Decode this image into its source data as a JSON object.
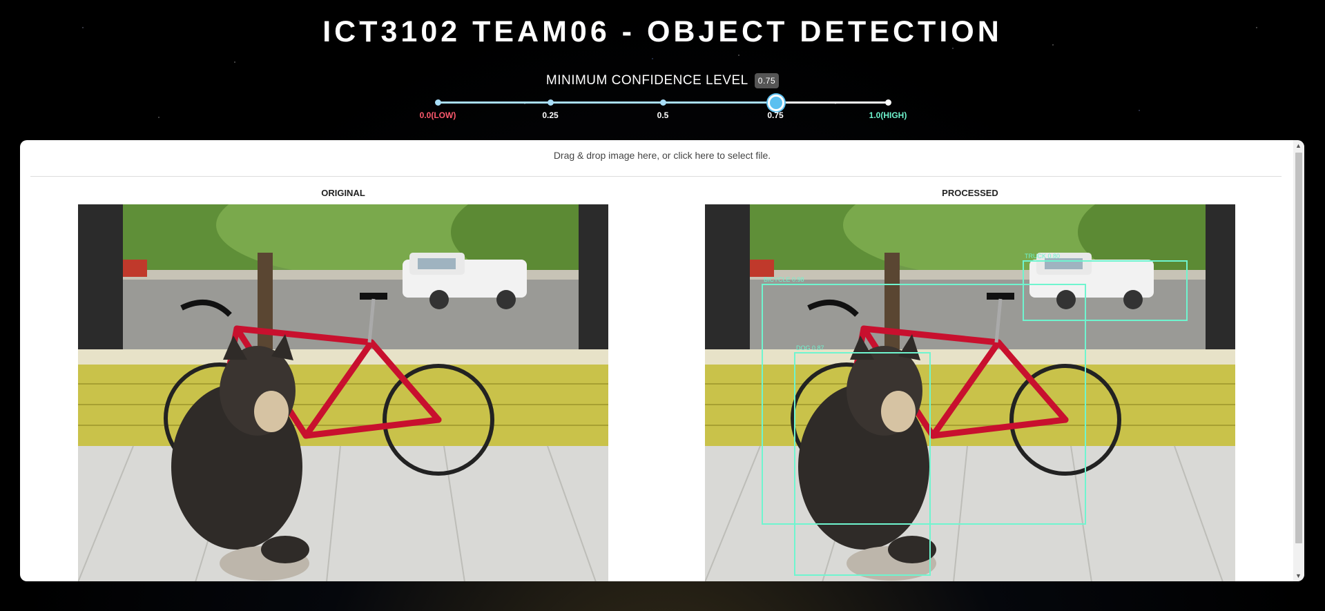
{
  "header": {
    "title": "ICT3102 TEAM06 - OBJECT DETECTION"
  },
  "confidence": {
    "label": "MINIMUM CONFIDENCE LEVEL",
    "value_display": "0.75",
    "value": 0.75,
    "ticks": [
      {
        "label": "0.0(LOW)",
        "value": 0.0,
        "color": "#ff5a6e"
      },
      {
        "label": "0.25",
        "value": 0.25,
        "color": "#ffffff"
      },
      {
        "label": "0.5",
        "value": 0.5,
        "color": "#ffffff"
      },
      {
        "label": "0.75",
        "value": 0.75,
        "color": "#ffffff"
      },
      {
        "label": "1.0(HIGH)",
        "value": 1.0,
        "color": "#6ff5cf"
      }
    ],
    "accent": "#5bc0f0"
  },
  "upload": {
    "dropzone_text": "Drag & drop image here, or click here to select file."
  },
  "panels": {
    "original_title": "ORIGINAL",
    "processed_title": "PROCESSED"
  },
  "detections": [
    {
      "label": "BICYCLE 0.98"
    },
    {
      "label": "DOG 0.87"
    },
    {
      "label": "TRUCK 0.80"
    }
  ],
  "colors": {
    "box": "#6ff5cf",
    "low": "#ff5a6e",
    "high": "#6ff5cf"
  }
}
